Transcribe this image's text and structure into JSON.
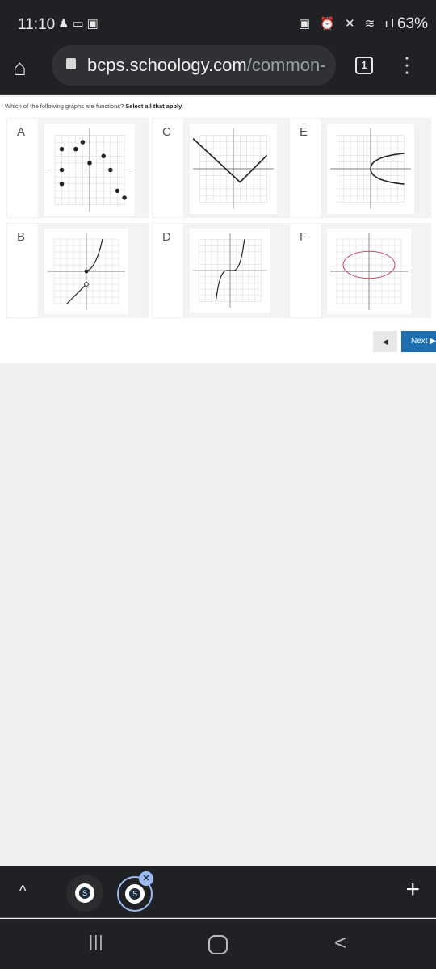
{
  "status_bar": {
    "time": "11:10",
    "notification_icons": [
      "snapchat-icon",
      "screen-mirror-icon",
      "gallery-icon"
    ],
    "system_icons": [
      "battery-saver-icon",
      "alarm-icon",
      "mute-icon",
      "wifi-icon",
      "signal-icon"
    ],
    "battery": "63%"
  },
  "browser": {
    "url_domain": "bcps.schoology.com",
    "url_path": "/common-",
    "tab_count": "1"
  },
  "question": {
    "text": "Which of the following graphs are functions?",
    "emphasis": "Select all that apply."
  },
  "options": [
    {
      "label": "A"
    },
    {
      "label": "B"
    },
    {
      "label": "C"
    },
    {
      "label": "D"
    },
    {
      "label": "E"
    },
    {
      "label": "F"
    }
  ],
  "graph_colors": {
    "curve": "#222222",
    "ellipse": "#c0405a",
    "grid": "#cccccc"
  },
  "pager": {
    "prev_symbol": "◀",
    "next_label": "Next ▶"
  },
  "tab_strip": {
    "favicon_letter": "S",
    "close_symbol": "✕",
    "new_tab": "+",
    "collapse": "^"
  },
  "nav": {
    "recents": "|||",
    "back": "<"
  }
}
